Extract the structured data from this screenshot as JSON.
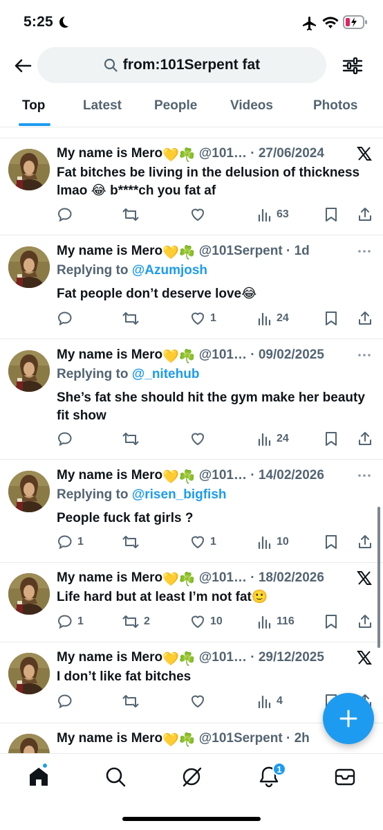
{
  "status_bar": {
    "time": "5:25"
  },
  "search": {
    "query": "from:101Serpent fat"
  },
  "tabs": [
    {
      "label": "Top",
      "active": true
    },
    {
      "label": "Latest",
      "active": false
    },
    {
      "label": "People",
      "active": false
    },
    {
      "label": "Videos",
      "active": false
    },
    {
      "label": "Photos",
      "active": false
    }
  ],
  "tweets": [
    {
      "name": "My name is Mero",
      "emojis": "💛☘️",
      "handle": "@101…",
      "date": "27/06/2024",
      "replying_to": "",
      "text": "Fat bitches be living in the delusion of thickness lmao 😂 b****ch you fat af",
      "replies": "",
      "retweets": "",
      "likes": "",
      "views": "63",
      "corner": "x-logo-icon"
    },
    {
      "name": "My name is Mero",
      "emojis": "💛☘️",
      "handle": "@101Serpent",
      "date": "1d",
      "replying_to": "@Azumjosh",
      "text": "Fat people don’t deserve love😂",
      "replies": "",
      "retweets": "",
      "likes": "1",
      "views": "24",
      "corner": "more-icon"
    },
    {
      "name": "My name is Mero",
      "emojis": "💛☘️",
      "handle": "@101…",
      "date": "09/02/2025",
      "replying_to": "@_nitehub",
      "text": "She’s fat she should hit the gym make her beauty fit show",
      "replies": "",
      "retweets": "",
      "likes": "",
      "views": "24",
      "corner": "more-icon"
    },
    {
      "name": "My name is Mero",
      "emojis": "💛☘️",
      "handle": "@101…",
      "date": "14/02/2026",
      "replying_to": "@risen_bigfish",
      "text": "People fuck fat girls ?",
      "replies": "1",
      "retweets": "",
      "likes": "1",
      "views": "10",
      "corner": "more-icon"
    },
    {
      "name": "My name is Mero",
      "emojis": "💛☘️",
      "handle": "@101…",
      "date": "18/02/2026",
      "replying_to": "",
      "text": "Life hard but at least I’m not fat🙂",
      "replies": "1",
      "retweets": "2",
      "likes": "10",
      "views": "116",
      "corner": "x-logo-icon"
    },
    {
      "name": "My name is Mero",
      "emojis": "💛☘️",
      "handle": "@101…",
      "date": "29/12/2025",
      "replying_to": "",
      "text": "I don’t like fat bitches",
      "replies": "",
      "retweets": "",
      "likes": "",
      "views": "4",
      "corner": "x-logo-icon"
    },
    {
      "name": "My name is Mero",
      "emojis": "💛☘️",
      "handle": "@101Serpent",
      "date": "2h",
      "replying_to": "",
      "text": "",
      "replies": "",
      "retweets": "",
      "likes": "",
      "views": "",
      "corner": ""
    }
  ],
  "labels": {
    "replying_prefix": "Replying to "
  },
  "bottom_nav": {
    "notifications_badge": "1"
  },
  "colors": {
    "accent": "#1d9bf0",
    "text": "#0f1419",
    "muted": "#536471",
    "divider": "#e7e9ea"
  }
}
